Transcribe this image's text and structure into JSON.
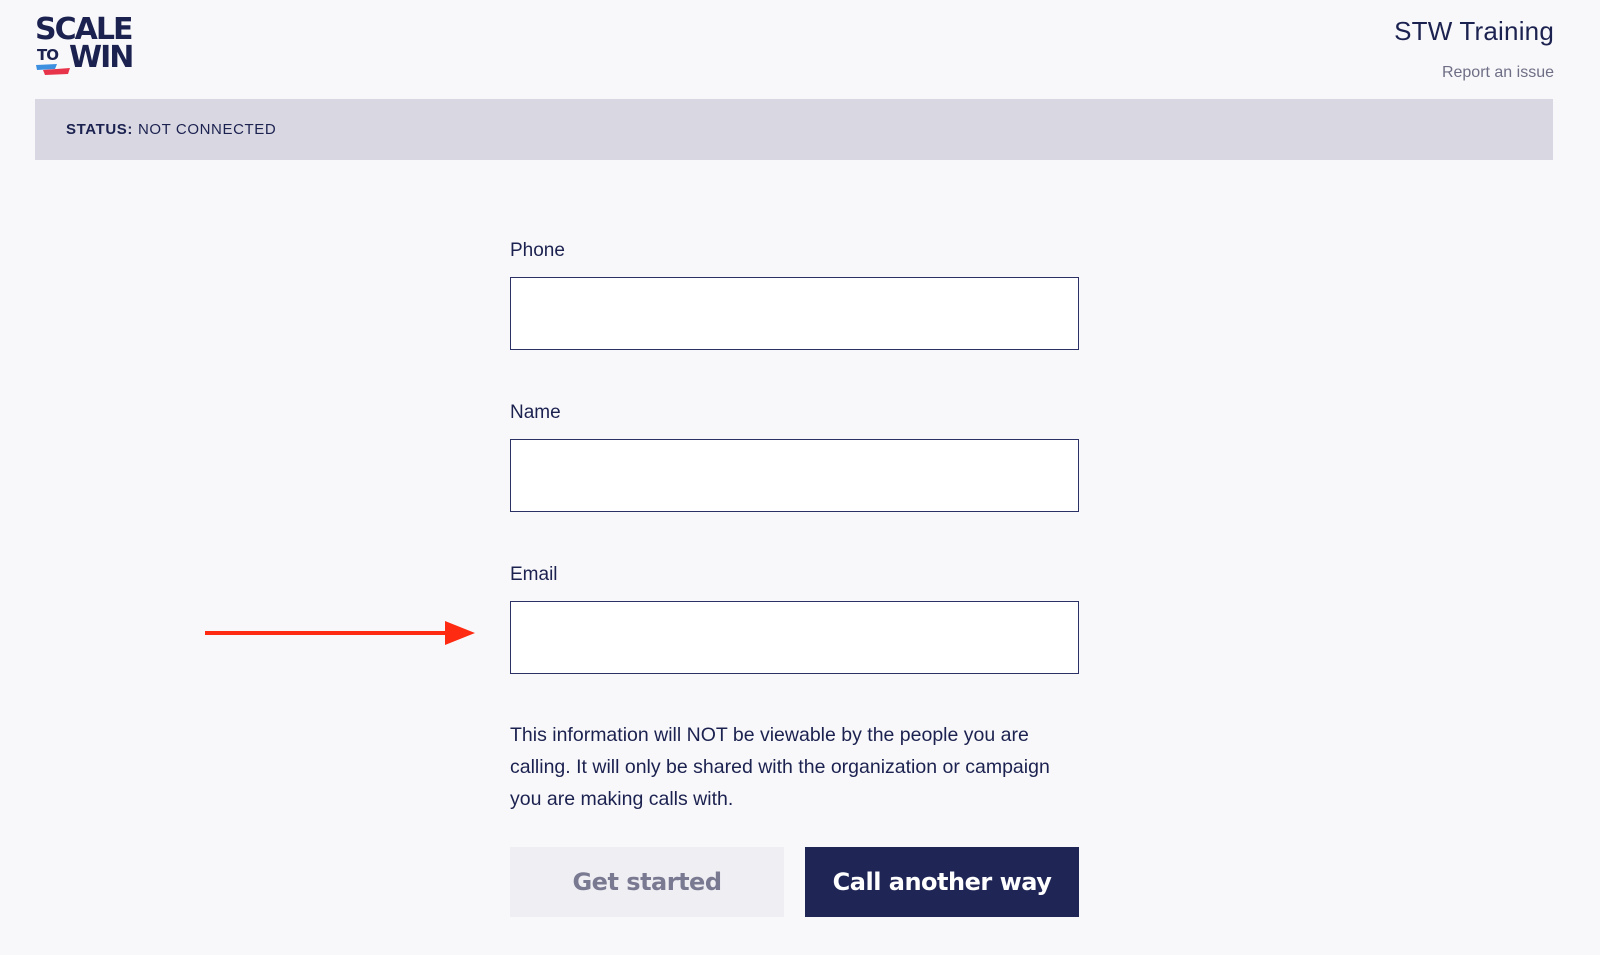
{
  "logo": {
    "line1": "SCALE",
    "line2_small": "TO",
    "line2_big": "WIN",
    "colors": {
      "navy": "#1c2250",
      "blue": "#3d8fe0",
      "red": "#e8344a"
    }
  },
  "header": {
    "title": "STW Training",
    "report_link": "Report an issue"
  },
  "status": {
    "label": "STATUS:",
    "value": "NOT CONNECTED"
  },
  "form": {
    "fields": [
      {
        "label": "Phone",
        "value": "",
        "placeholder": ""
      },
      {
        "label": "Name",
        "value": "",
        "placeholder": ""
      },
      {
        "label": "Email",
        "value": "",
        "placeholder": ""
      }
    ],
    "disclaimer": "This information will NOT be viewable by the people you are calling. It will only be shared with the organization or campaign you are making calls with."
  },
  "buttons": {
    "get_started": "Get started",
    "call_another_way": "Call another way"
  },
  "annotation": {
    "icon": "red-arrow-icon",
    "color": "#ff2a12"
  }
}
